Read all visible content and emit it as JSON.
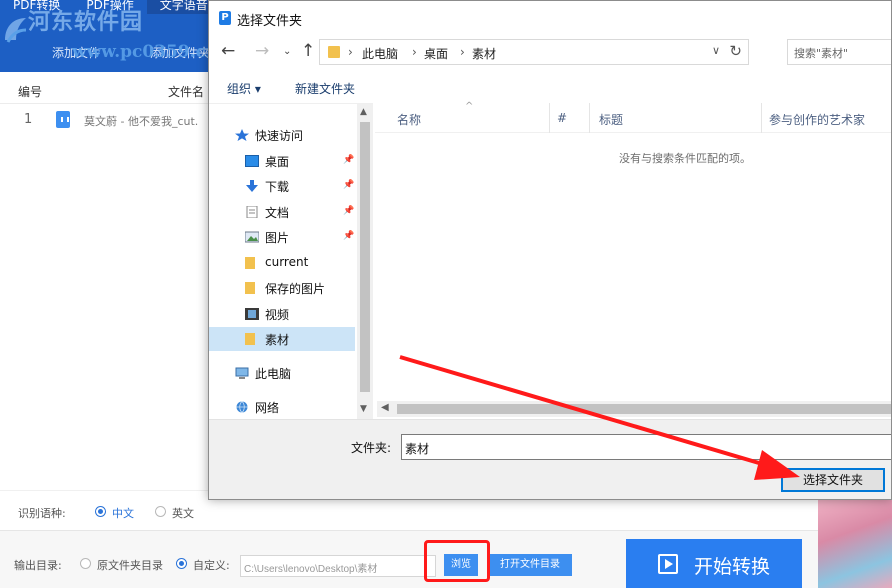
{
  "app": {
    "tabs": [
      "PDF转换",
      "PDF操作",
      "文字语音"
    ],
    "watermark_text": "河东软件园",
    "watermark_url": "www.pc0359.cn",
    "toolbar": {
      "add_file": "添加文件",
      "add_folder": "添加文件夹"
    },
    "table": {
      "col_index": "编号",
      "col_filename": "文件名"
    },
    "files": [
      {
        "index": "1",
        "name": "莫文蔚 - 他不爱我_cut."
      }
    ],
    "recognition": {
      "label": "识别语种:",
      "options": [
        "中文",
        "英文"
      ],
      "selected": "中文"
    },
    "output": {
      "label": "输出目录:",
      "option_original": "原文件夹目录",
      "option_custom": "自定义:",
      "path": "C:\\Users\\lenovo\\Desktop\\素材",
      "browse_label": "浏览",
      "open_folder_label": "打开文件目录"
    },
    "start_button": "开始转换",
    "accent_color": "#2a7ef0",
    "highlight_color": "#ff1a1a"
  },
  "dialog": {
    "title": "选择文件夹",
    "title_icon": "P",
    "breadcrumb": [
      "此电脑",
      "桌面",
      "素材"
    ],
    "search_placeholder": "搜索\"素材\"",
    "commands": {
      "organize": "组织 ▾",
      "new_folder": "新建文件夹"
    },
    "nav_items": [
      {
        "label": "快速访问",
        "icon": "star-icon"
      },
      {
        "label": "桌面",
        "icon": "desktop-icon",
        "pinned": true
      },
      {
        "label": "下载",
        "icon": "download-icon",
        "pinned": true
      },
      {
        "label": "文档",
        "icon": "document-icon",
        "pinned": true
      },
      {
        "label": "图片",
        "icon": "picture-icon",
        "pinned": true
      },
      {
        "label": "current",
        "icon": "folder-icon"
      },
      {
        "label": "保存的图片",
        "icon": "folder-icon"
      },
      {
        "label": "视频",
        "icon": "video-icon"
      },
      {
        "label": "素材",
        "icon": "folder-icon",
        "selected": true
      },
      {
        "label": "此电脑",
        "icon": "computer-icon"
      },
      {
        "label": "网络",
        "icon": "network-icon"
      }
    ],
    "columns": [
      "名称",
      "#",
      "标题",
      "参与创作的艺术家"
    ],
    "empty_message": "没有与搜索条件匹配的项。",
    "folder_label": "文件夹:",
    "folder_value": "素材",
    "select_button": "选择文件夹"
  }
}
